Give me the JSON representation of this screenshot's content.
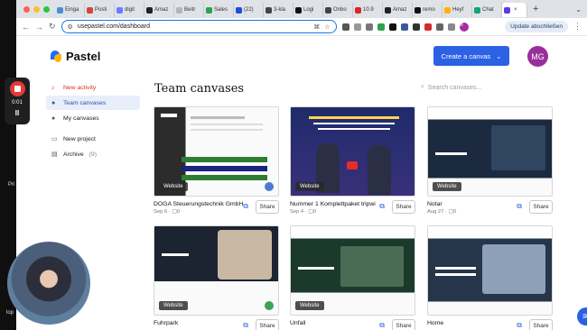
{
  "browser": {
    "tabs": [
      "Einga",
      "Posti",
      "digit",
      "Amaz",
      "Beitr",
      "Sales",
      "(22)",
      "3-kla",
      "Logi",
      "Onbo",
      "10.9",
      "Amaz",
      "remo",
      "Heyf",
      "Chat",
      ""
    ],
    "tab_colors": [
      "#4a90d9",
      "#d44638",
      "#6b7cff",
      "#222",
      "#b5b5b5",
      "#2ba24c",
      "#1d4ed8",
      "#444",
      "#111",
      "#444",
      "#d42a2a",
      "#222",
      "#111",
      "#ffb300",
      "#10a37f",
      "#5b3bdb"
    ],
    "url": "usepastel.com/dashboard",
    "update_label": "Update abschließen",
    "profile_initial": "M"
  },
  "app": {
    "brand": "Pastel",
    "create_button": "Create a canvas",
    "user_initials": "MG",
    "accent": "#2b62e3"
  },
  "sidebar": {
    "items": [
      {
        "label": "New activity",
        "icon": "bell-icon"
      },
      {
        "label": "Team canvases",
        "icon": "team-icon"
      },
      {
        "label": "My canvases",
        "icon": "user-icon"
      },
      {
        "label": "New project",
        "icon": "folder-plus-icon"
      },
      {
        "label": "Archive",
        "count": "(9)",
        "icon": "archive-icon"
      }
    ]
  },
  "main": {
    "title": "Team canvases",
    "search_placeholder": "Search canvases...",
    "share_label": "Share",
    "badge_label": "Website",
    "cards": [
      {
        "name": "DOGA Steuerungstechnik GmbH",
        "date": "Sep 6",
        "comments": "0"
      },
      {
        "name": "Nummer 1 Komplettpaket tripwi",
        "date": "Sep 4",
        "comments": "0"
      },
      {
        "name": "Notar",
        "date": "Aug 27",
        "comments": "0"
      },
      {
        "name": "Fuhrpark",
        "date": "",
        "comments": ""
      },
      {
        "name": "Unfall",
        "date": "",
        "comments": ""
      },
      {
        "name": "Home",
        "date": "",
        "comments": ""
      }
    ]
  },
  "recorder": {
    "time": "0:01"
  },
  "edge_labels": [
    "Pri",
    "lop"
  ]
}
